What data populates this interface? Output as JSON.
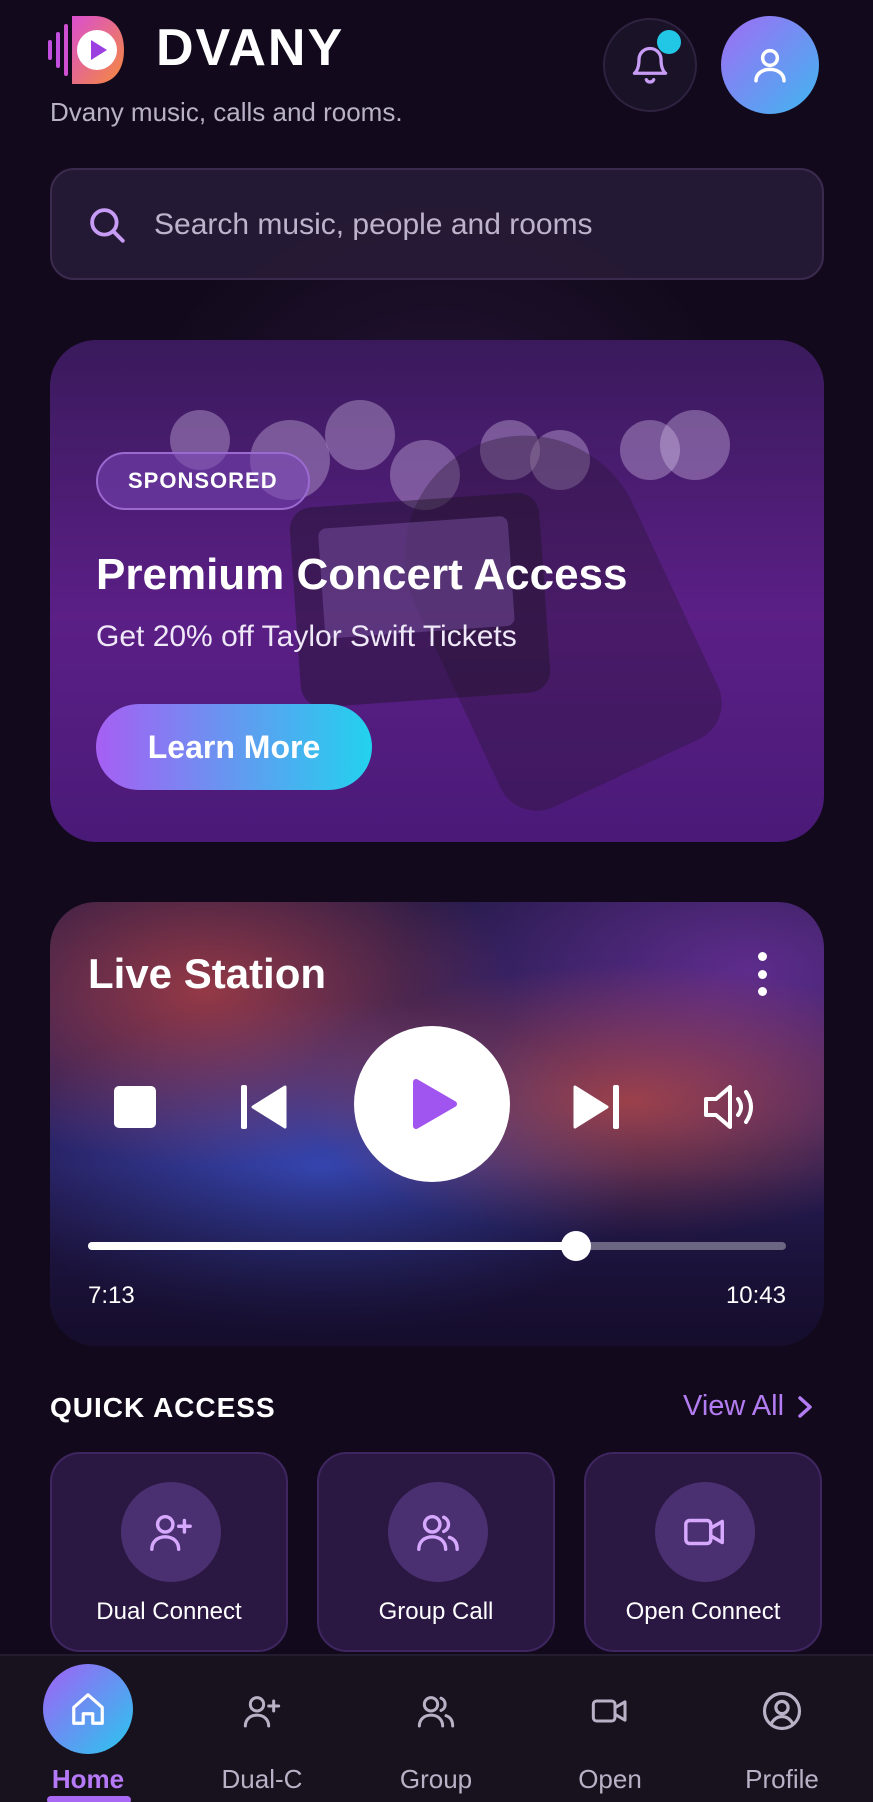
{
  "app": {
    "brand": "DVANY",
    "tagline": "Dvany music, calls and rooms."
  },
  "header": {
    "notification_icon": "bell-icon",
    "notification_dot_color": "#22c7e6",
    "profile_icon": "user-icon"
  },
  "search": {
    "placeholder": "Search music, people and rooms",
    "value": ""
  },
  "promo": {
    "badge": "SPONSORED",
    "title": "Premium Concert Access",
    "subtitle": "Get 20% off Taylor Swift Tickets",
    "cta": "Learn More"
  },
  "player": {
    "title": "Live Station",
    "current_time": "7:13",
    "total_time": "10:43",
    "progress_fraction": 0.699,
    "controls": [
      "stop-icon",
      "skip-previous-icon",
      "play-icon",
      "skip-next-icon",
      "volume-icon"
    ]
  },
  "quick_access": {
    "title": "QUICK ACCESS",
    "view_all": "View All",
    "items": [
      {
        "label": "Dual Connect",
        "icon": "user-plus-icon"
      },
      {
        "label": "Group Call",
        "icon": "users-icon"
      },
      {
        "label": "Open Connect",
        "icon": "video-icon"
      }
    ]
  },
  "nav": {
    "items": [
      {
        "label": "Home",
        "icon": "home-icon",
        "active": true
      },
      {
        "label": "Dual-C",
        "icon": "user-plus-icon",
        "active": false
      },
      {
        "label": "Group",
        "icon": "users-icon",
        "active": false
      },
      {
        "label": "Open",
        "icon": "video-icon",
        "active": false
      },
      {
        "label": "Profile",
        "icon": "profile-circle-icon",
        "active": false
      }
    ]
  },
  "colors": {
    "background": "#120a1c",
    "accent_purple": "#b37cf2",
    "accent_cyan": "#22d2ee"
  }
}
